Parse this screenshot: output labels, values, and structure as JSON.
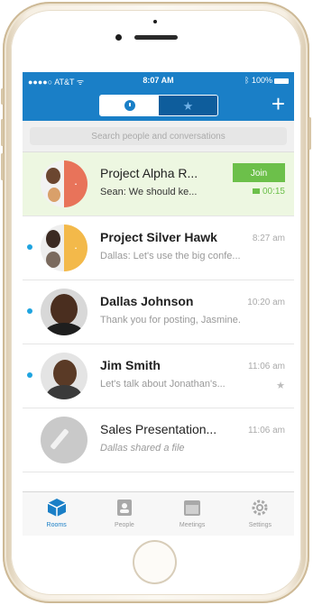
{
  "status_bar": {
    "carrier": "AT&T",
    "time": "8:07 AM",
    "battery": "100%"
  },
  "nav": {
    "segments": [
      {
        "name": "recent",
        "icon": "clock-icon",
        "active": true
      },
      {
        "name": "favorites",
        "icon": "star-icon",
        "active": false
      }
    ],
    "add_label": "+"
  },
  "search": {
    "placeholder": "Search people and conversations"
  },
  "conversations": [
    {
      "title": "Project Alpha R...",
      "subtitle": "Sean: We should ke...",
      "join_label": "Join",
      "duration": "00:15",
      "active_call": true,
      "unread": false
    },
    {
      "title": "Project Silver Hawk",
      "time": "8:27 am",
      "subtitle": "Dallas: Let's use the big confe...",
      "unread": true
    },
    {
      "title": "Dallas Johnson",
      "time": "10:20 am",
      "subtitle": "Thank you for posting, Jasmine.",
      "unread": true
    },
    {
      "title": "Jim Smith",
      "time": "11:06 am",
      "subtitle": "Let's talk about Jonathan's...",
      "unread": true,
      "starred": true
    },
    {
      "title": "Sales Presentation...",
      "time": "11:06 am",
      "subtitle": "Dallas shared a file",
      "unread": false
    }
  ],
  "tabs": [
    {
      "label": "Rooms",
      "icon": "rooms-cube-icon",
      "active": true
    },
    {
      "label": "People",
      "icon": "contacts-icon",
      "active": false
    },
    {
      "label": "Meetings",
      "icon": "calendar-icon",
      "active": false
    },
    {
      "label": "Settings",
      "icon": "gear-icon",
      "active": false
    }
  ],
  "colors": {
    "accent": "#1a7fc7",
    "join_green": "#6cc04a",
    "unread_dot": "#1fa4e0",
    "highlight_row": "#edf7e1"
  }
}
